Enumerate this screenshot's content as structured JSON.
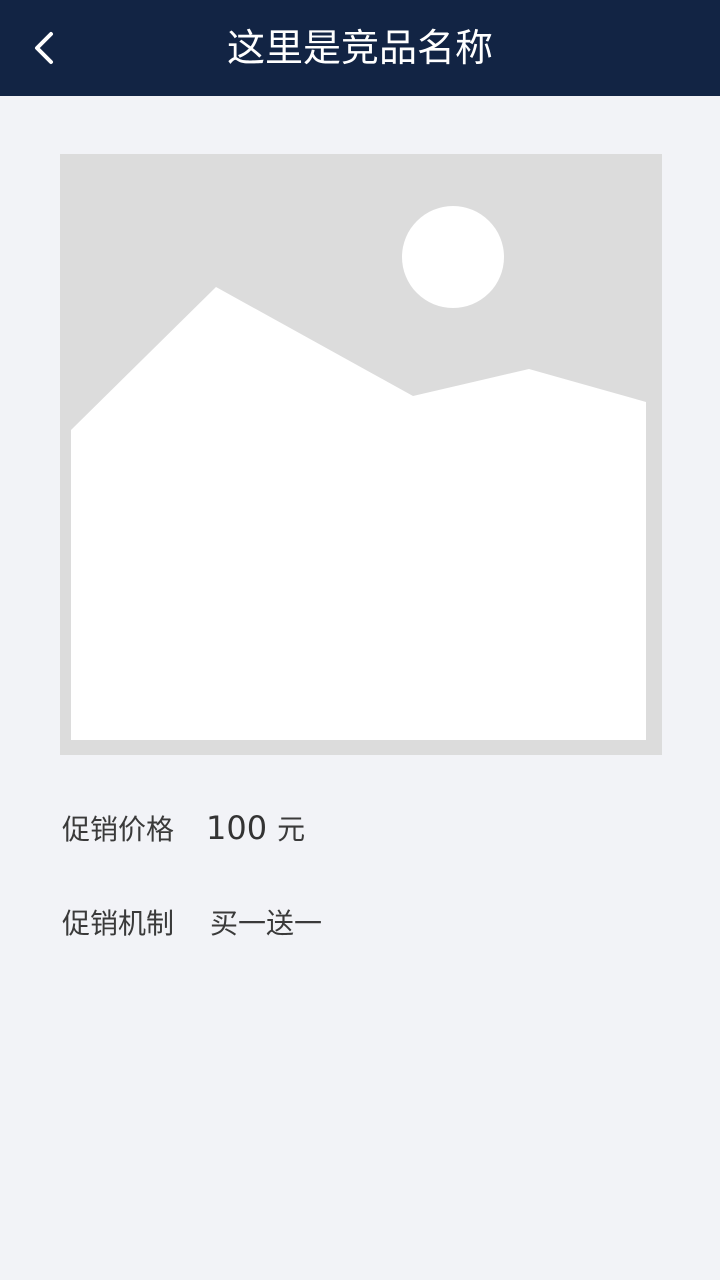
{
  "header": {
    "title": "这里是竞品名称",
    "back_icon": "chevron-left-icon"
  },
  "product": {
    "image_icon": "image-placeholder-icon"
  },
  "promotion": {
    "price_label": "促销价格",
    "price_value": "100",
    "price_unit": "元",
    "mechanism_label": "促销机制",
    "mechanism_value": "买一送一"
  },
  "colors": {
    "header_bg": "#122444",
    "page_bg": "#f2f3f7",
    "placeholder_bg": "#dcdcdc"
  }
}
